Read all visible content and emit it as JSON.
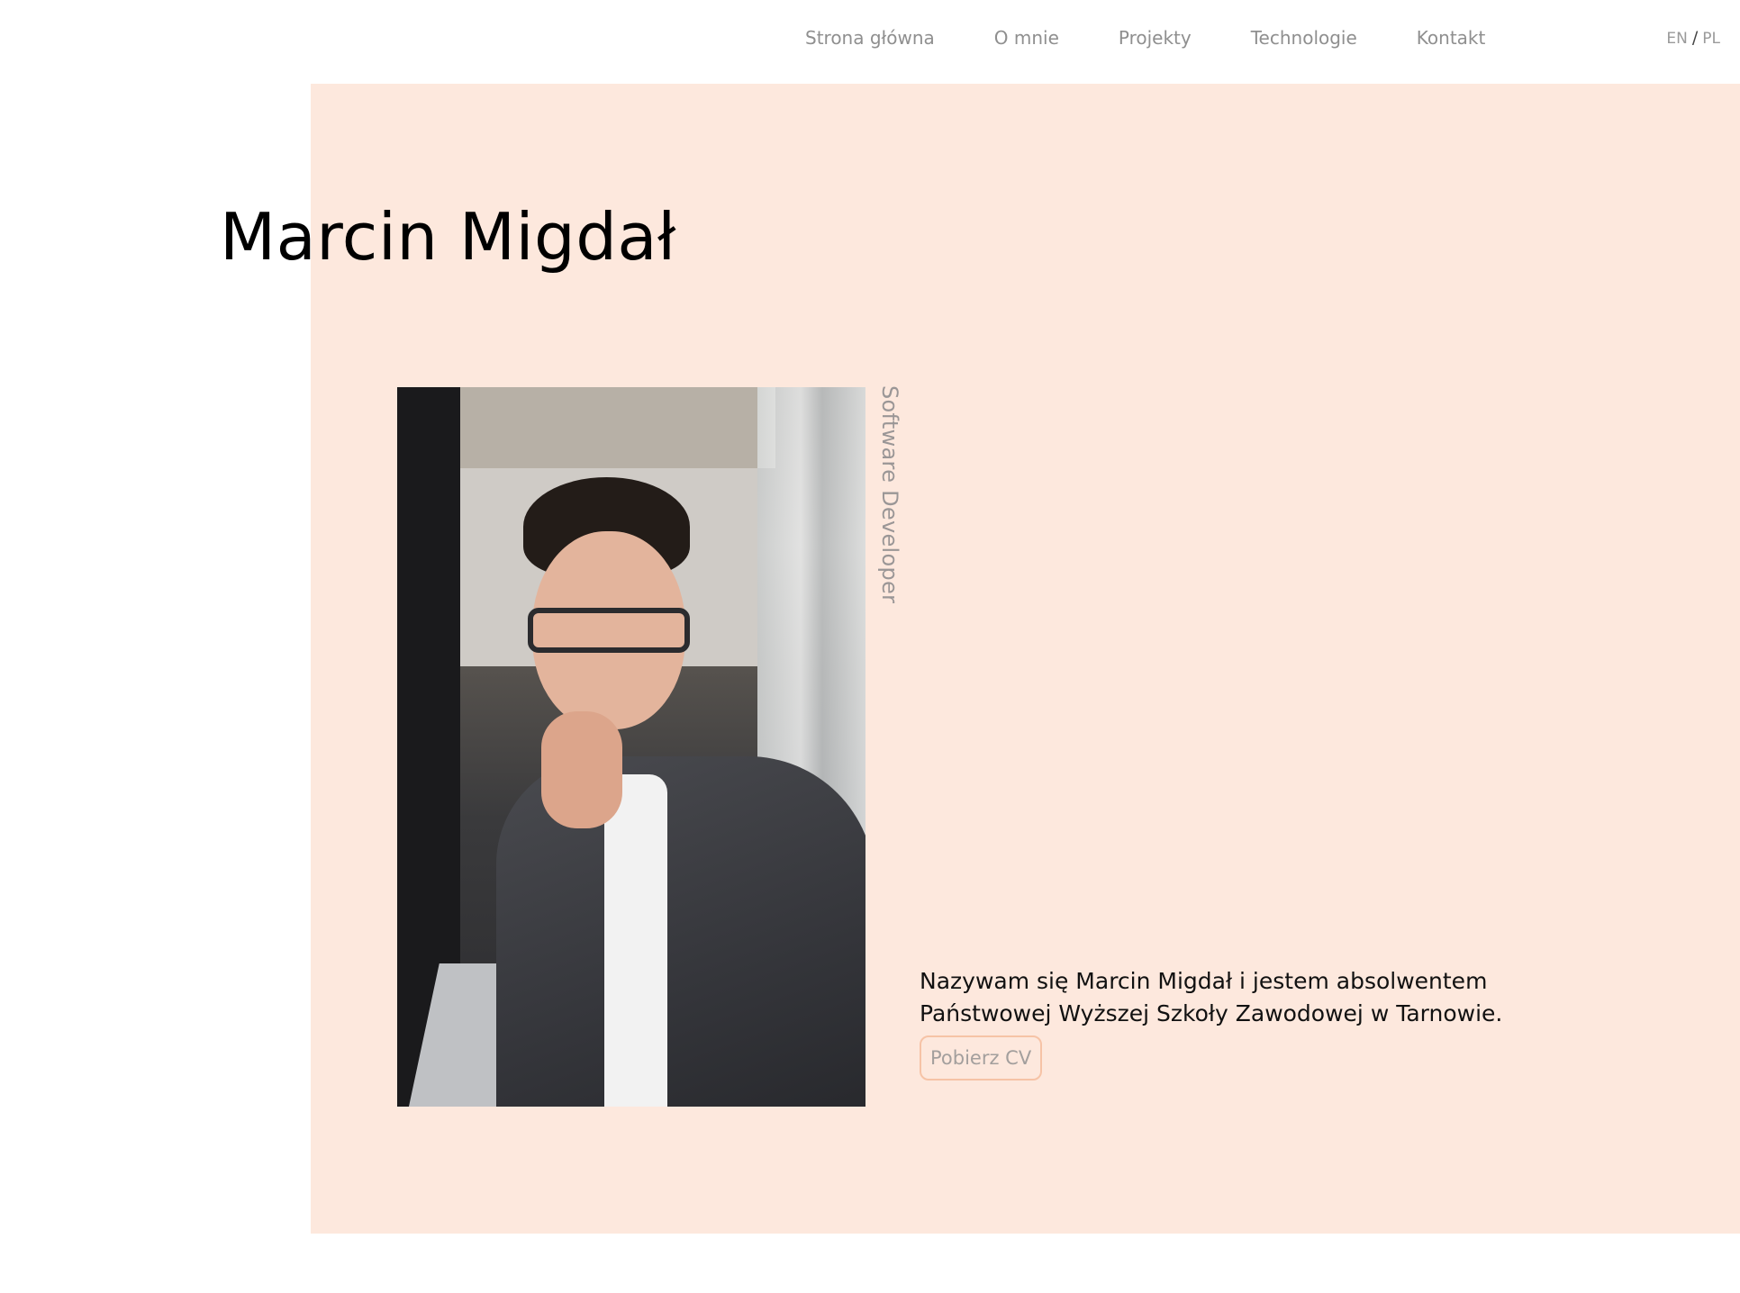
{
  "nav": {
    "items": [
      {
        "label": "Strona główna"
      },
      {
        "label": "O mnie"
      },
      {
        "label": "Projekty"
      },
      {
        "label": "Technologie"
      },
      {
        "label": "Kontakt"
      }
    ],
    "lang_en": "EN",
    "lang_sep": "/",
    "lang_pl": "PL"
  },
  "hero": {
    "name": "Marcin Migdał",
    "subtitle": "Software Developer",
    "intro": "Nazywam się Marcin Migdał i jestem absolwentem Państwowej Wyższej Szkoły Zawodowej w Tarnowie.",
    "cv_label": "Pobierz CV"
  },
  "colors": {
    "hero_background": "#fde8dd",
    "button_border": "#f6c3a6",
    "nav_text": "#8f8f8f"
  }
}
